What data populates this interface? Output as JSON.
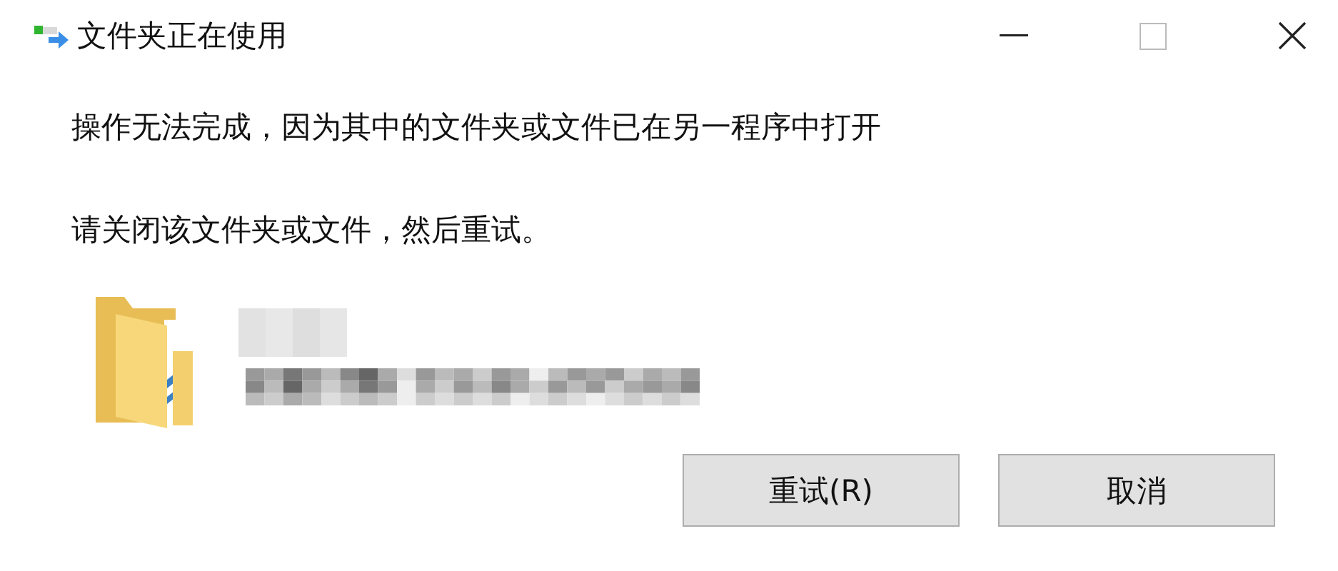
{
  "window": {
    "title": "文件夹正在使用"
  },
  "messages": [
    "操作无法完成，因为其中的文件夹或文件已在另一程序中打开",
    "请关闭该文件夹或文件，然后重试。"
  ],
  "buttons": [
    {
      "label": "重试(R)"
    },
    {
      "label": "取消"
    }
  ]
}
